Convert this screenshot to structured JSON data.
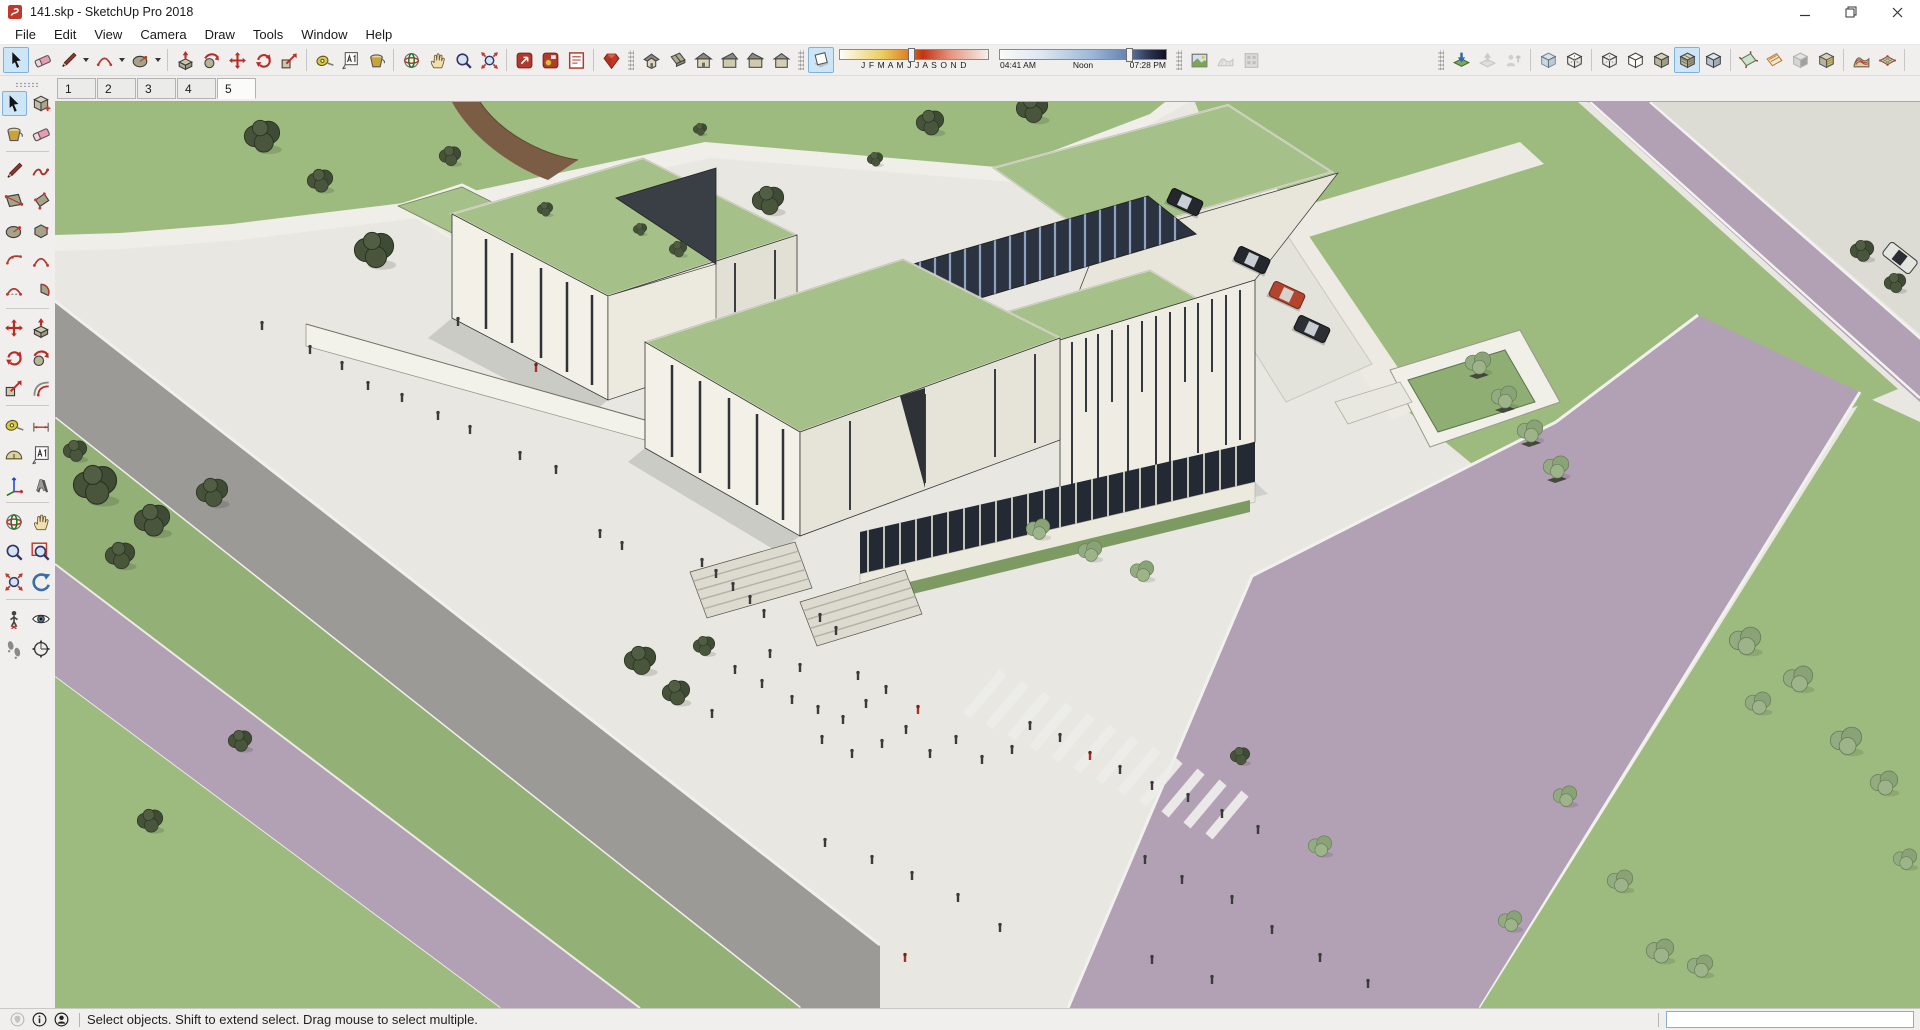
{
  "window": {
    "title": "141.skp - SketchUp Pro 2018",
    "app_icon": "sketchup-logo",
    "controls": [
      "minimize",
      "restore",
      "close"
    ]
  },
  "menu": {
    "items": [
      "File",
      "Edit",
      "View",
      "Camera",
      "Draw",
      "Tools",
      "Window",
      "Help"
    ]
  },
  "toolbar": {
    "groups": [
      {
        "name": "principal",
        "icons": [
          "select",
          "eraser",
          "line",
          "arc",
          "shapes"
        ],
        "active": "select"
      },
      {
        "name": "edit",
        "icons": [
          "push-pull",
          "follow-me",
          "move",
          "rotate",
          "scale"
        ]
      },
      {
        "name": "construction",
        "icons": [
          "tape-measure",
          "text",
          "paint-bucket"
        ]
      },
      {
        "name": "camera",
        "icons": [
          "orbit",
          "pan",
          "zoom",
          "zoom-extents"
        ]
      },
      {
        "name": "layout",
        "icons": [
          "send-to-layout",
          "layout-presentation",
          "layout-document"
        ]
      },
      {
        "name": "warehouse",
        "icons": [
          "extension-warehouse"
        ]
      },
      {
        "name": "views",
        "icons": [
          "iso-view",
          "top-view",
          "front-view",
          "right-view",
          "left-view",
          "back-view"
        ]
      },
      {
        "name": "shadows",
        "icons": [
          "shadow-toggle",
          "date-slider",
          "time-slider"
        ],
        "active": "shadow-toggle"
      },
      {
        "name": "location",
        "icons": [
          "add-location",
          "toggle-terrain",
          "photo-textures"
        ]
      },
      {
        "name": "3d-warehouse",
        "icons": [
          "get-models",
          "share-model",
          "share-component"
        ]
      },
      {
        "name": "styles",
        "icons": [
          "x-ray",
          "back-edges",
          "wireframe",
          "hidden-line",
          "shaded",
          "shaded-with-textures",
          "monochrome"
        ],
        "active": "shaded-with-textures"
      },
      {
        "name": "sections",
        "icons": [
          "section-plane",
          "display-section-planes",
          "display-section-cuts",
          "display-section-fill"
        ]
      },
      {
        "name": "sandbox",
        "icons": [
          "from-contours",
          "from-scratch"
        ]
      }
    ]
  },
  "shadows": {
    "months_label": "J F M A M J J A S O N D",
    "sunrise": "04:41 AM",
    "noon": "Noon",
    "sunset": "07:28 PM"
  },
  "scene_tabs": {
    "tabs": [
      "1",
      "2",
      "3",
      "4",
      "5"
    ],
    "active_tab": "5"
  },
  "palette": {
    "icons": [
      "select",
      "make-component",
      "paint-bucket",
      "eraser",
      "line",
      "freehand",
      "rectangle",
      "rotated-rectangle",
      "circle",
      "polygon",
      "arc",
      "two-point-arc",
      "three-point-arc",
      "pie",
      "move",
      "push-pull",
      "rotate",
      "follow-me",
      "scale",
      "offset",
      "tape-measure",
      "dimension",
      "protractor",
      "text",
      "axes",
      "3d-text",
      "orbit",
      "pan",
      "zoom",
      "zoom-window",
      "zoom-extents",
      "previous-view",
      "position-camera",
      "look-around",
      "walk",
      "compass"
    ],
    "active": "select"
  },
  "status": {
    "message": "Select objects. Shift to extend select. Drag mouse to select multiple.",
    "icons": [
      "geolocation",
      "help",
      "account"
    ],
    "measurements_value": ""
  },
  "canvas": {
    "colors": {
      "plaza": "#e8e7e2",
      "grass": "#9dba7f",
      "roof_green": "#a5c189",
      "road_gray": "#9b9a96",
      "sidewalk_mauve": "#b2a0b4",
      "wall_white": "#f2f0e7",
      "wall_shade": "#e2e0d5",
      "glazing_dark": "#232a33",
      "skylight_blue": "#2c3340",
      "tree_dark": "#46523a",
      "tree_light": "#93ab80",
      "accent_red_car": "#b3452e"
    }
  }
}
